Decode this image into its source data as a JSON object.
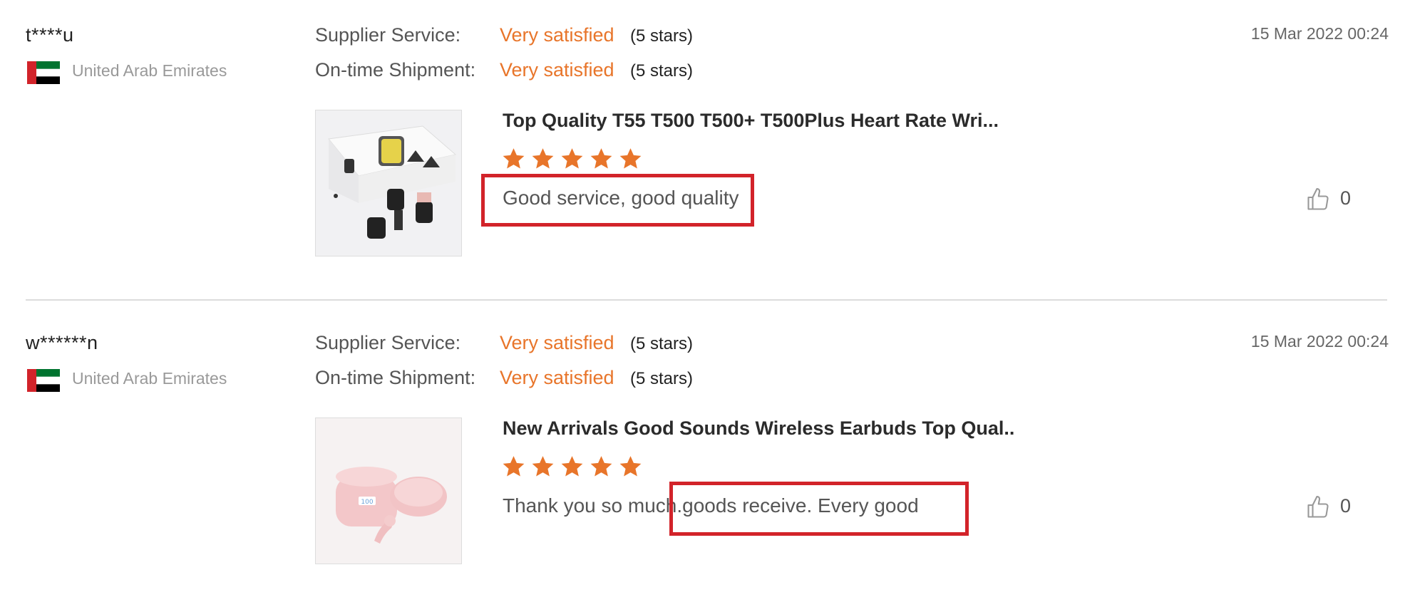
{
  "colors": {
    "accent": "#e8752a",
    "highlight_box": "#d2232a",
    "divider": "#dcdcdc"
  },
  "reviews": [
    {
      "username": "t****u",
      "country": "United Arab Emirates",
      "flag_icon": "uae-flag-icon",
      "supplier_label": "Supplier Service:",
      "supplier_value": "Very satisfied",
      "supplier_stars": "(5 stars)",
      "shipment_label": "On-time Shipment:",
      "shipment_value": "Very satisfied",
      "shipment_stars": "(5 stars)",
      "date": "15 Mar 2022 00:24",
      "product_title": "Top Quality T55 T500 T500+ T500Plus Heart Rate Wri...",
      "product_rating": 5,
      "comment": "Good service, good quality",
      "like_icon": "thumbs-up-icon",
      "likes": "0"
    },
    {
      "username": "w******n",
      "country": "United Arab Emirates",
      "flag_icon": "uae-flag-icon",
      "supplier_label": "Supplier Service:",
      "supplier_value": "Very satisfied",
      "supplier_stars": "(5 stars)",
      "shipment_label": "On-time Shipment:",
      "shipment_value": "Very satisfied",
      "shipment_stars": "(5 stars)",
      "date": "15 Mar 2022 00:24",
      "product_title": "New Arrivals Good Sounds Wireless Earbuds Top Qual...",
      "product_rating": 5,
      "comment": "Thank you so much.goods receive. Every good",
      "like_icon": "thumbs-up-icon",
      "likes": "0"
    }
  ]
}
